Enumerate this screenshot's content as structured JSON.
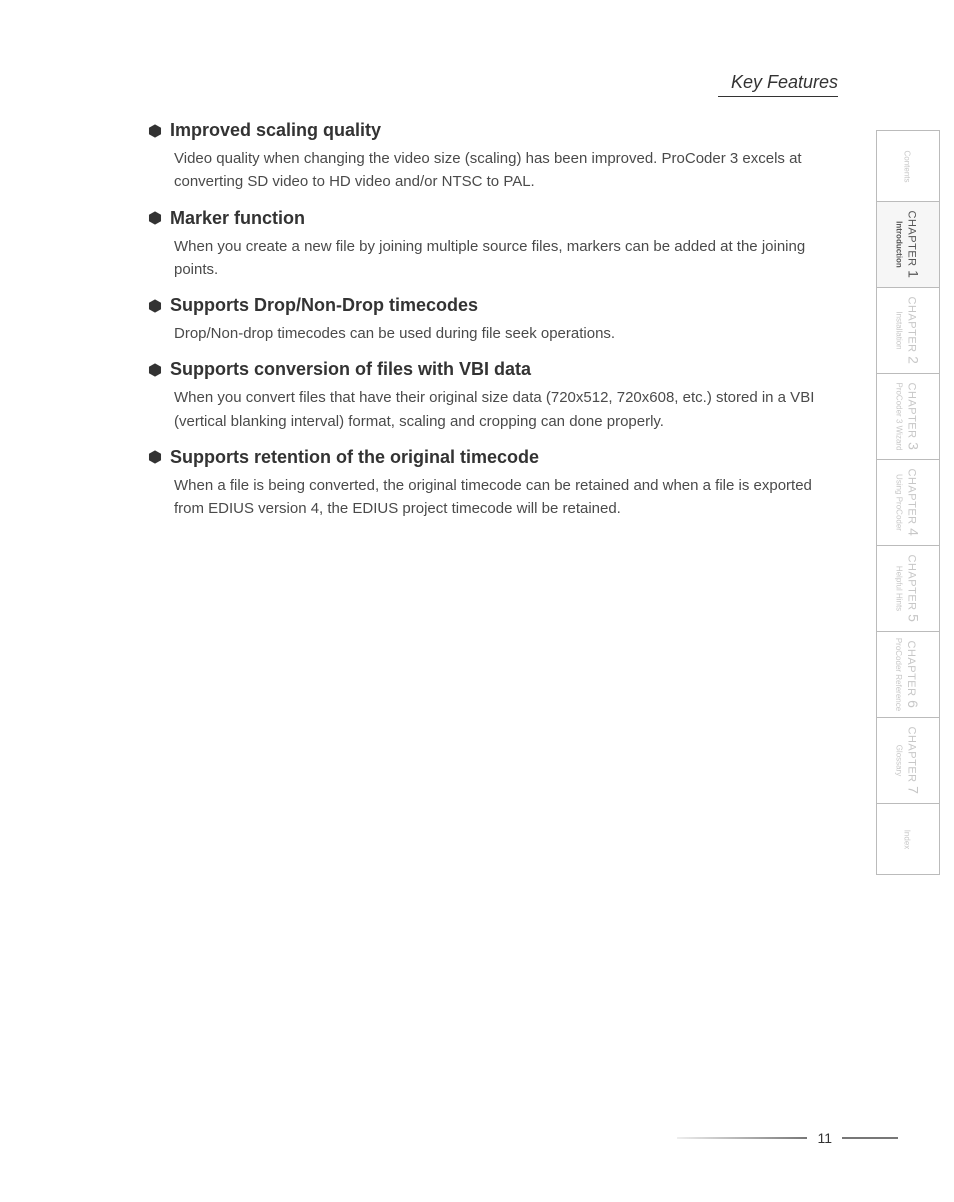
{
  "header": {
    "title": "Key Features"
  },
  "sections": [
    {
      "title": "Improved scaling quality",
      "body": "Video quality when changing the video size (scaling) has been improved. ProCoder 3 excels at converting SD video to HD video and/or NTSC to PAL."
    },
    {
      "title": "Marker function",
      "body": "When you create a new file by joining multiple source files, markers can be added at the joining points."
    },
    {
      "title": "Supports Drop/Non-Drop timecodes",
      "body": "Drop/Non-drop timecodes can be used during file seek operations."
    },
    {
      "title": "Supports conversion of files with VBI data",
      "body": "When you convert files that have their original size data (720x512, 720x608, etc.) stored in a VBI (vertical blanking interval) format, scaling and cropping can done properly."
    },
    {
      "title": "Supports retention of the original timecode",
      "body": "When a file is being converted, the original timecode can be retained and when a file is exported from EDIUS version 4, the EDIUS project timecode will be retained."
    }
  ],
  "tabs": [
    {
      "chapter": "",
      "num": "",
      "sub": "Contents",
      "active": false,
      "short": true
    },
    {
      "chapter": "CHAPTER",
      "num": "1",
      "sub": "Introduction",
      "active": true,
      "short": false
    },
    {
      "chapter": "CHAPTER",
      "num": "2",
      "sub": "Installation",
      "active": false,
      "short": false
    },
    {
      "chapter": "CHAPTER",
      "num": "3",
      "sub": "ProCoder 3 Wizard",
      "active": false,
      "short": false
    },
    {
      "chapter": "CHAPTER",
      "num": "4",
      "sub": "Using ProCoder",
      "active": false,
      "short": false
    },
    {
      "chapter": "CHAPTER",
      "num": "5",
      "sub": "Helpful Hints",
      "active": false,
      "short": false
    },
    {
      "chapter": "CHAPTER",
      "num": "6",
      "sub": "ProCoder Reference",
      "active": false,
      "short": false
    },
    {
      "chapter": "CHAPTER",
      "num": "7",
      "sub": "Glossary",
      "active": false,
      "short": false
    },
    {
      "chapter": "",
      "num": "",
      "sub": "Index",
      "active": false,
      "short": true
    }
  ],
  "footer": {
    "page": "11"
  }
}
